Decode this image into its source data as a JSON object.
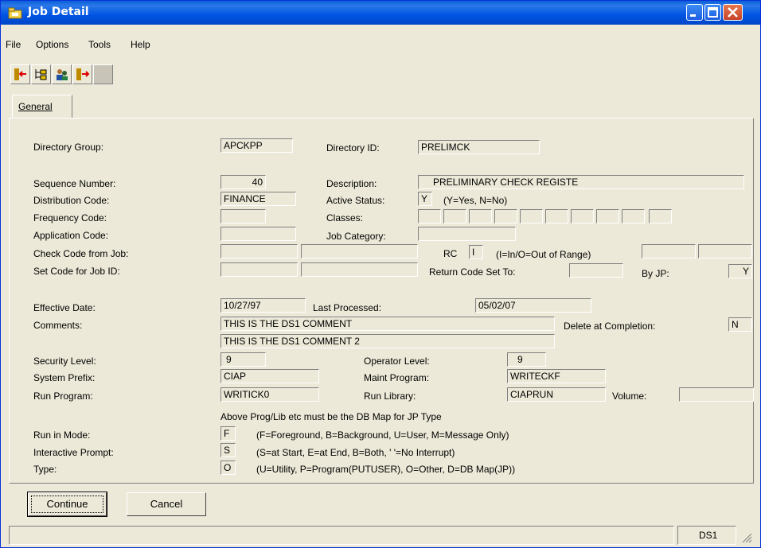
{
  "window": {
    "title": "Job Detail"
  },
  "menu": [
    "File",
    "Options",
    "Tools",
    "Help"
  ],
  "tab": {
    "label": "General"
  },
  "labels": {
    "directory_group": "Directory Group:",
    "directory_id": "Directory ID:",
    "sequence_number": "Sequence Number:",
    "description": "Description:",
    "distribution_code": "Distribution Code:",
    "active_status": "Active Status:",
    "active_status_hint": "(Y=Yes, N=No)",
    "frequency_code": "Frequency Code:",
    "classes": "Classes:",
    "application_code": "Application Code:",
    "job_category": "Job Category:",
    "check_code": "Check Code from Job:",
    "rc": "RC",
    "rc_hint": "(I=In/O=Out of Range)",
    "set_code": "Set Code for Job ID:",
    "return_code_set_to": "Return Code Set To:",
    "by_jp": "By JP:",
    "effective_date": "Effective Date:",
    "last_processed": "Last Processed:",
    "comments": "Comments:",
    "delete_at_completion": "Delete at Completion:",
    "security_level": "Security Level:",
    "operator_level": "Operator Level:",
    "system_prefix": "System Prefix:",
    "maint_program": "Maint Program:",
    "run_program": "Run Program:",
    "run_library": "Run Library:",
    "volume": "Volume:",
    "db_map_note": "Above Prog/Lib etc must be the DB Map for JP Type",
    "run_in_mode": "Run in Mode:",
    "run_in_mode_hint": "(F=Foreground, B=Background, U=User, M=Message Only)",
    "interactive_prompt": "Interactive Prompt:",
    "interactive_prompt_hint": "(S=at Start, E=at End, B=Both, ' '=No Interrupt)",
    "type": "Type:",
    "type_hint": "(U=Utility, P=Program(PUTUSER), O=Other, D=DB Map(JP))"
  },
  "values": {
    "directory_group": "APCKPP",
    "directory_id": "PRELIMCK",
    "sequence_number": "40",
    "description": "PRELIMINARY CHECK REGISTE",
    "distribution_code": "FINANCE",
    "active_status": "Y",
    "rc": "I",
    "by_jp": "Y",
    "effective_date": "10/27/97",
    "last_processed": "05/02/07",
    "comment_1": "THIS IS THE DS1 COMMENT",
    "comment_2": "THIS IS THE DS1 COMMENT 2",
    "delete_at_completion": "N",
    "security_level": "9",
    "operator_level": "9",
    "system_prefix": "CIAP",
    "maint_program": "WRITECKF",
    "run_program": "WRITICK0",
    "run_library": "CIAPRUN",
    "run_in_mode": "F",
    "interactive_prompt": "S",
    "type": "O"
  },
  "buttons": {
    "continue": "Continue",
    "cancel": "Cancel"
  },
  "status": {
    "system": "DS1"
  },
  "colors": {
    "titlebar": "#0054e3",
    "window_bg": "#ece9d8"
  }
}
